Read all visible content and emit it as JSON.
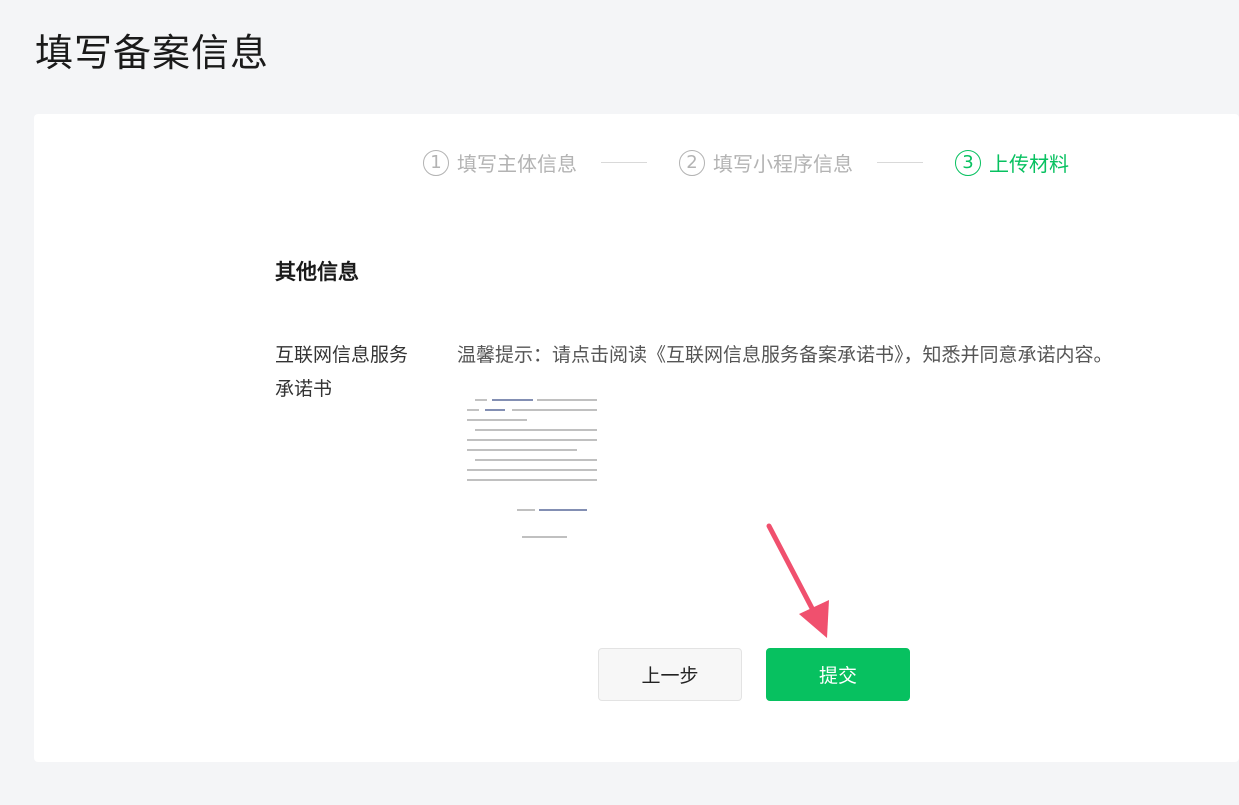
{
  "page": {
    "title": "填写备案信息"
  },
  "steps": [
    {
      "num": "1",
      "label": "填写主体信息",
      "state": "done"
    },
    {
      "num": "2",
      "label": "填写小程序信息",
      "state": "done"
    },
    {
      "num": "3",
      "label": "上传材料",
      "state": "active"
    }
  ],
  "section": {
    "title": "其他信息"
  },
  "commitment": {
    "label_line1": "互联网信息服务",
    "label_line2": "承诺书",
    "tip": "温馨提示：请点击阅读《互联网信息服务备案承诺书》，知悉并同意承诺内容。"
  },
  "buttons": {
    "prev": "上一步",
    "submit": "提交"
  },
  "colors": {
    "accent": "#07c160",
    "arrow": "#f0506e",
    "inactive": "#b3b3b3"
  },
  "icons": {
    "doc_preview": "document-thumbnail-icon",
    "pointer": "arrow-pointer-icon"
  }
}
